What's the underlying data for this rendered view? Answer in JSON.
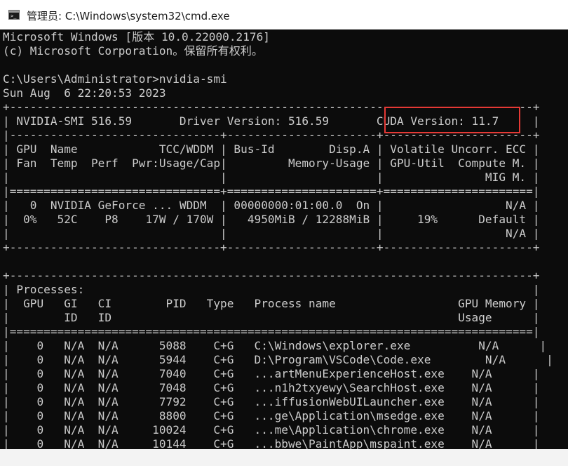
{
  "window": {
    "title": "管理员: C:\\Windows\\system32\\cmd.exe",
    "icon": "cmd-icon"
  },
  "console": {
    "lines": [
      "Microsoft Windows [版本 10.0.22000.2176]",
      "(c) Microsoft Corporation。保留所有权利。",
      "",
      "C:\\Users\\Administrator>nvidia-smi",
      "Sun Aug  6 22:20:53 2023",
      "+-----------------------------------------------------------------------------+",
      "| NVIDIA-SMI 516.59       Driver Version: 516.59       CUDA Version: 11.7     |",
      "|-------------------------------+----------------------+----------------------+",
      "| GPU  Name            TCC/WDDM | Bus-Id        Disp.A | Volatile Uncorr. ECC |",
      "| Fan  Temp  Perf  Pwr:Usage/Cap|         Memory-Usage | GPU-Util  Compute M. |",
      "|                               |                      |               MIG M. |",
      "|===============================+======================+======================|",
      "|   0  NVIDIA GeForce ... WDDM  | 00000000:01:00.0  On |                  N/A |",
      "|  0%   52C    P8    17W / 170W |   4950MiB / 12288MiB |     19%      Default |",
      "|                               |                      |                  N/A |",
      "+-------------------------------+----------------------+----------------------+",
      "",
      "+-----------------------------------------------------------------------------+",
      "| Processes:                                                                  |",
      "|  GPU   GI   CI        PID   Type   Process name                  GPU Memory |",
      "|        ID   ID                                                   Usage      |",
      "|=============================================================================|",
      "|    0   N/A  N/A      5088    C+G   C:\\Windows\\explorer.exe          N/A      |",
      "|    0   N/A  N/A      5944    C+G   D:\\Program\\VSCode\\Code.exe        N/A      |",
      "|    0   N/A  N/A      7040    C+G   ...artMenuExperienceHost.exe    N/A      |",
      "|    0   N/A  N/A      7048    C+G   ...n1h2txyewy\\SearchHost.exe    N/A      |",
      "|    0   N/A  N/A      7792    C+G   ...iffusionWebUILauncher.exe    N/A      |",
      "|    0   N/A  N/A      8800    C+G   ...ge\\Application\\msedge.exe    N/A      |",
      "|    0   N/A  N/A     10024    C+G   ...me\\Application\\chrome.exe    N/A      |",
      "|    0   N/A  N/A     10144    C+G   ...bbwe\\PaintApp\\mspaint.exe    N/A      |"
    ]
  },
  "annotation": {
    "highlighted_text": "CUDA Version: 11.7",
    "color": "#e53935"
  },
  "colors": {
    "console_bg": "#0c0c0c",
    "console_fg": "#cccccc",
    "titlebar_bg": "#ffffff"
  }
}
